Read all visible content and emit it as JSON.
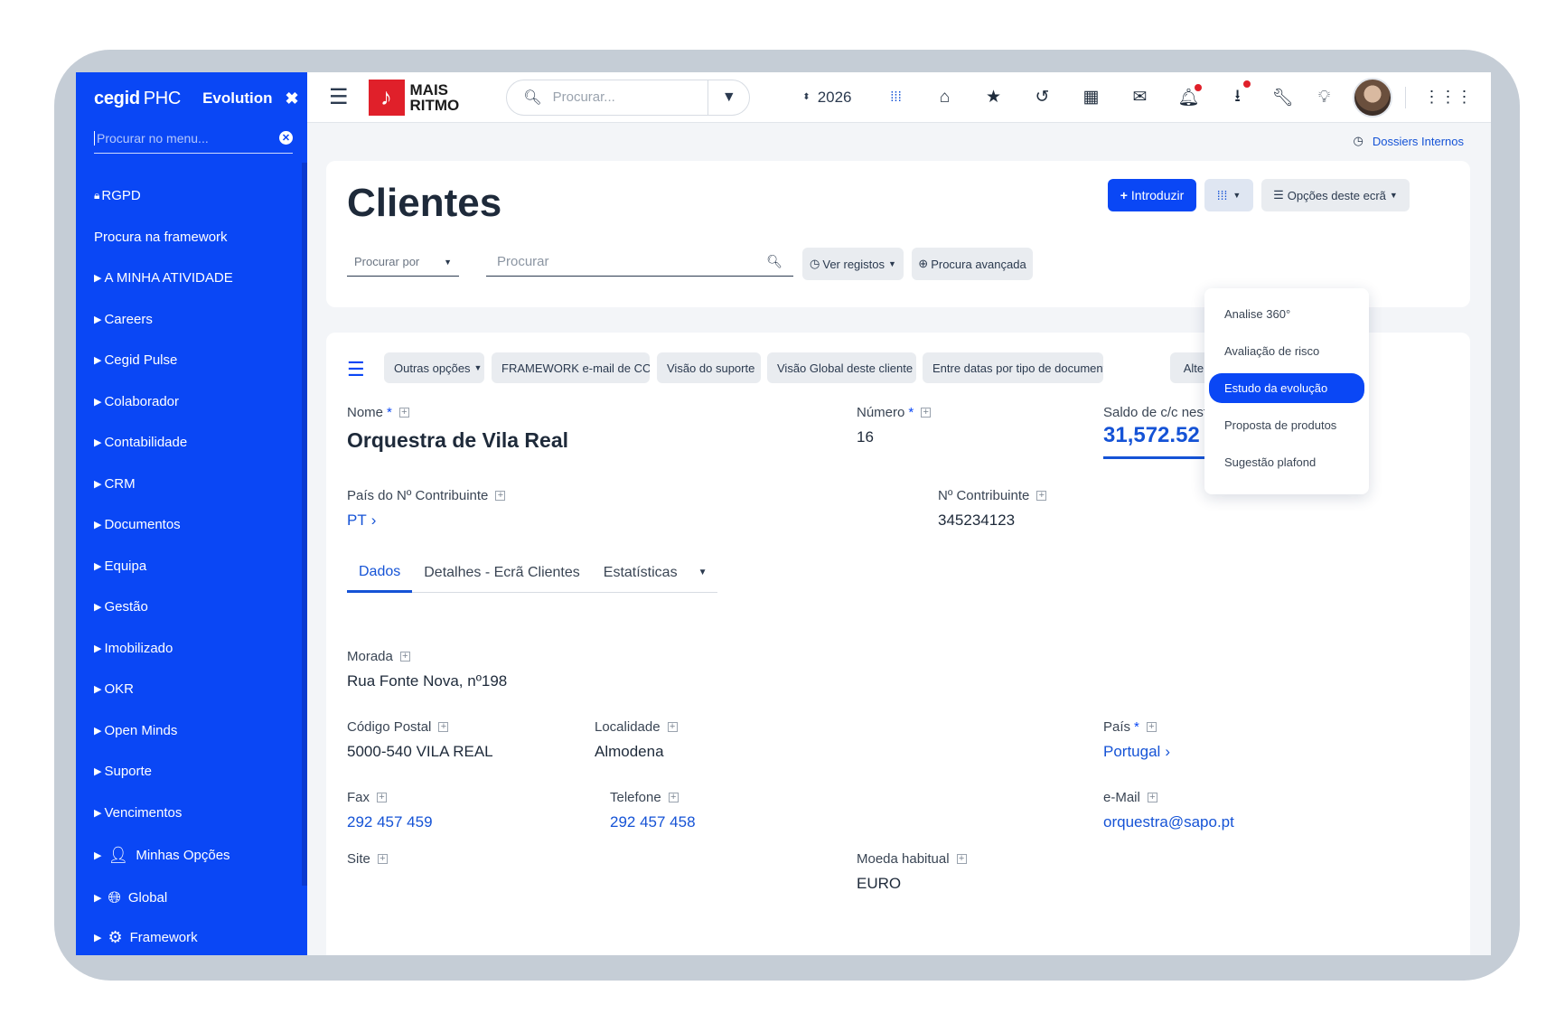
{
  "sidebar": {
    "brand": "cegid",
    "product": "PHC",
    "edition": "Evolution",
    "search_placeholder": "Procurar no menu...",
    "items": [
      {
        "label": "RGPD"
      },
      {
        "label": "Procura na framework"
      },
      {
        "label": "A MINHA ATIVIDADE"
      },
      {
        "label": "Careers"
      },
      {
        "label": "Cegid Pulse"
      },
      {
        "label": "Colaborador"
      },
      {
        "label": "Contabilidade"
      },
      {
        "label": "CRM"
      },
      {
        "label": "Documentos"
      },
      {
        "label": "Equipa"
      },
      {
        "label": "Gestão"
      },
      {
        "label": "Imobilizado"
      },
      {
        "label": "OKR"
      },
      {
        "label": "Open Minds"
      },
      {
        "label": "Suporte"
      },
      {
        "label": "Vencimentos"
      },
      {
        "label": "Minhas Opções"
      },
      {
        "label": "Global"
      },
      {
        "label": "Framework"
      }
    ]
  },
  "topbar": {
    "logo_line1": "MAIS",
    "logo_line2": "RITMO",
    "search_placeholder": "Procurar...",
    "year": "2026",
    "icons": [
      "grid-small-icon",
      "home-icon",
      "star-icon",
      "history-icon",
      "calendar-icon",
      "mail-icon",
      "bell-icon",
      "download-icon",
      "wrench-icon",
      "lightbulb-icon"
    ]
  },
  "breadcrumb": {
    "link": "Dossiers Internos"
  },
  "header": {
    "title": "Clientes",
    "introduzir": "Introduzir",
    "opcoes": "Opções deste ecrã",
    "procurar_por": "Procurar por",
    "procurar": "Procurar",
    "ver_registos": "Ver registos",
    "procura_avancada": "Procura avançada"
  },
  "toolbar": {
    "outras_opcoes": "Outras opções",
    "framework_email": "FRAMEWORK e-mail de CC",
    "visao_suporte": "Visão do suporte",
    "visao_global": "Visão Global deste cliente",
    "entre_datas": "Entre datas por tipo de documento",
    "alterar": "Alterar"
  },
  "dropdown": {
    "items": [
      "Analise 360°",
      "Avaliação de risco",
      "Estudo da evolução",
      "Proposta de produtos",
      "Sugestão plafond"
    ],
    "selected": "Estudo da evolução"
  },
  "record": {
    "nome_label": "Nome",
    "nome": "Orquestra de Vila Real",
    "numero_label": "Número",
    "numero": "16",
    "saldo_label": "Saldo de c/c neste momento",
    "saldo": "31,572.52",
    "pais_contrib_label": "País do Nº Contribuinte",
    "pais_contrib": "PT",
    "contribuinte_label": "Nº Contribuinte",
    "contribuinte": "345234123",
    "morada_label": "Morada",
    "morada": "Rua Fonte Nova, nº198",
    "codigo_postal_label": "Código Postal",
    "codigo_postal": "5000-540 VILA REAL",
    "localidade_label": "Localidade",
    "localidade": "Almodena",
    "pais_label": "País",
    "pais": "Portugal",
    "fax_label": "Fax",
    "fax": "292 457 459",
    "telefone_label": "Telefone",
    "telefone": "292 457 458",
    "email_label": "e-Mail",
    "email": "orquestra@sapo.pt",
    "site_label": "Site",
    "moeda_label": "Moeda habitual",
    "moeda": "EURO"
  },
  "tabs": [
    "Dados",
    "Detalhes - Ecrã Clientes",
    "Estatísticas"
  ],
  "colors": {
    "accent": "#0a47f5",
    "link": "#1553d6",
    "logo_red": "#e0202a"
  }
}
